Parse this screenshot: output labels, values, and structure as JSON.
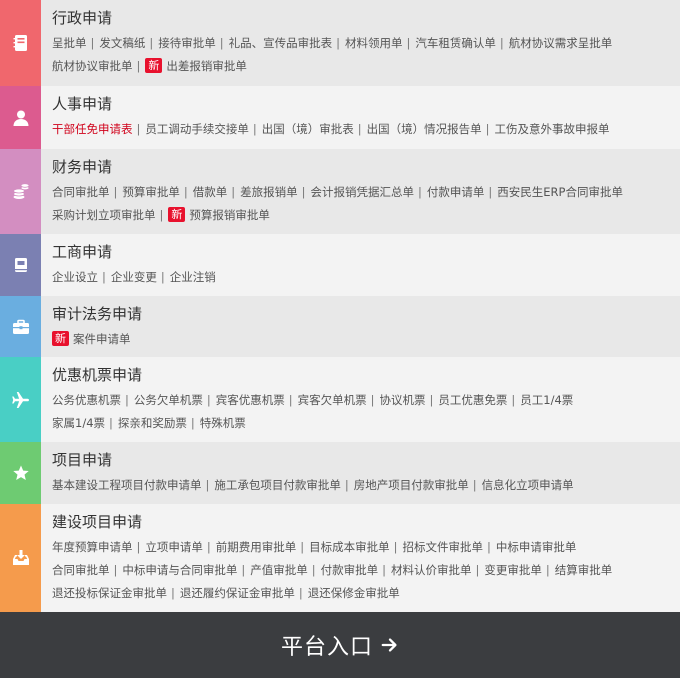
{
  "colors": {
    "xingzheng": "#f0676d",
    "renshi": "#dc5b8f",
    "caiwu": "#d38ec1",
    "gongshang": "#7b80b2",
    "shenji": "#6aaee0",
    "jipiao": "#49cfc5",
    "xiangmu": "#6ecb72",
    "jianshe": "#f59b4c"
  },
  "sections": [
    {
      "title": "行政申请",
      "icon": "notebook-icon",
      "items": [
        "呈批单",
        "发文稿纸",
        "接待审批单",
        "礼品、宣传品审批表",
        "材料领用单",
        "汽车租赁确认单",
        "航材协议需求呈批单",
        "航材协议审批单"
      ],
      "new_item": "出差报销审批单"
    },
    {
      "title": "人事申请",
      "icon": "user-icon",
      "highlight_item": "干部任免申请表",
      "items": [
        "员工调动手续交接单",
        "出国（境）审批表",
        "出国（境）情况报告单",
        "工伤及意外事故申报单"
      ]
    },
    {
      "title": "财务申请",
      "icon": "coins-icon",
      "items": [
        "合同审批单",
        "预算审批单",
        "借款单",
        "差旅报销单",
        "会计报销凭据汇总单",
        "付款申请单",
        "西安民生ERP合同审批单",
        "采购计划立项审批单"
      ],
      "new_item": "预算报销审批单"
    },
    {
      "title": "工商申请",
      "icon": "book-icon",
      "items": [
        "企业设立",
        "企业变更",
        "企业注销"
      ]
    },
    {
      "title": "审计法务申请",
      "icon": "briefcase-icon",
      "items": [],
      "new_item": "案件申请单"
    },
    {
      "title": "优惠机票申请",
      "icon": "airplane-icon",
      "items": [
        "公务优惠机票",
        "公务欠单机票",
        "宾客优惠机票",
        "宾客欠单机票",
        "协议机票",
        "员工优惠免票",
        "员工1/4票",
        "家属1/4票",
        "探亲和奖励票",
        "特殊机票"
      ]
    },
    {
      "title": "项目申请",
      "icon": "star-icon",
      "items": [
        "基本建设工程项目付款申请单",
        "施工承包项目付款审批单",
        "房地产项目付款审批单",
        "信息化立项申请单"
      ]
    },
    {
      "title": "建设项目申请",
      "icon": "inbox-download-icon",
      "items": [
        "年度预算申请单",
        "立项申请单",
        "前期费用审批单",
        "目标成本审批单",
        "招标文件审批单",
        "中标申请审批单",
        "合同审批单",
        "中标申请与合同审批单",
        "产值审批单",
        "付款审批单",
        "材料认价审批单",
        "变更审批单",
        "结算审批单",
        "退还投标保证金审批单",
        "退还履约保证金审批单",
        "退还保修金审批单"
      ]
    }
  ],
  "new_badge": "新",
  "separator": "|",
  "bottom_button": "平台入口"
}
